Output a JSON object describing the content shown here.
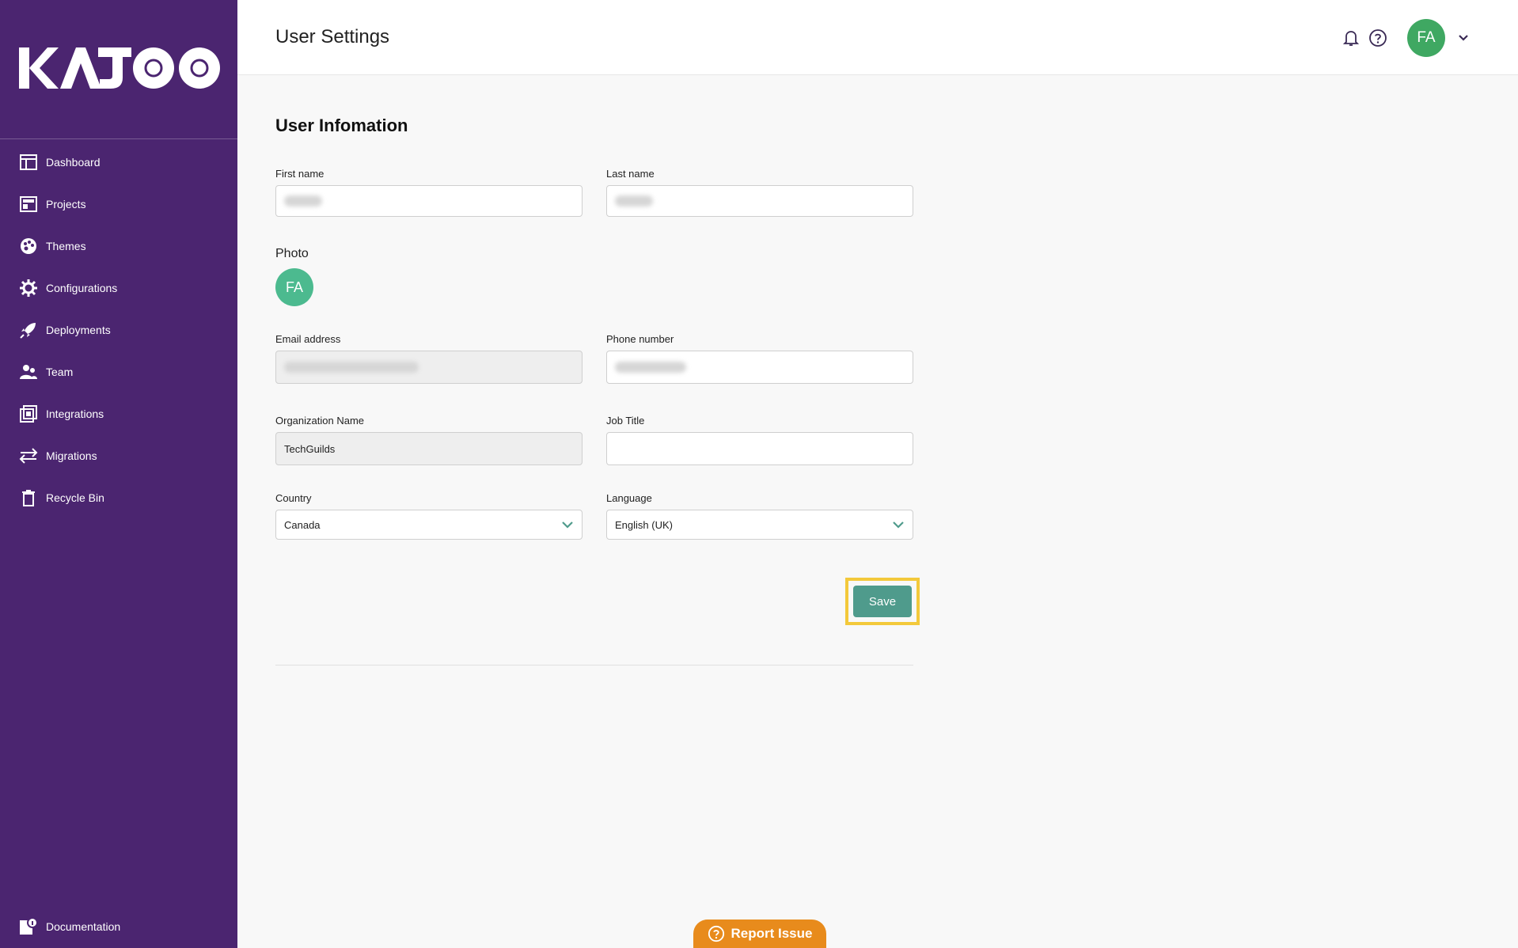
{
  "brand": {
    "logo": "KAJOO"
  },
  "sidebar": {
    "items": [
      {
        "label": "Dashboard",
        "icon": "dashboard-icon"
      },
      {
        "label": "Projects",
        "icon": "projects-icon"
      },
      {
        "label": "Themes",
        "icon": "palette-icon"
      },
      {
        "label": "Configurations",
        "icon": "gear-icon"
      },
      {
        "label": "Deployments",
        "icon": "rocket-icon"
      },
      {
        "label": "Team",
        "icon": "team-icon"
      },
      {
        "label": "Integrations",
        "icon": "integrations-icon"
      },
      {
        "label": "Migrations",
        "icon": "arrows-icon"
      },
      {
        "label": "Recycle Bin",
        "icon": "trash-icon"
      }
    ],
    "bottom": {
      "label": "Documentation",
      "icon": "documentation-icon"
    }
  },
  "header": {
    "title": "User Settings",
    "avatar_initials": "FA"
  },
  "form": {
    "section_title": "User Infomation",
    "first_name": {
      "label": "First name",
      "value": ""
    },
    "last_name": {
      "label": "Last name",
      "value": ""
    },
    "photo": {
      "label": "Photo",
      "initials": "FA"
    },
    "email": {
      "label": "Email address",
      "value": ""
    },
    "phone": {
      "label": "Phone number",
      "value": ""
    },
    "organization": {
      "label": "Organization Name",
      "value": "TechGuilds"
    },
    "job_title": {
      "label": "Job Title",
      "value": ""
    },
    "country": {
      "label": "Country",
      "value": "Canada"
    },
    "language": {
      "label": "Language",
      "value": "English (UK)"
    },
    "save_label": "Save"
  },
  "report": {
    "label": "Report Issue"
  },
  "colors": {
    "sidebar": "#4b2570",
    "accent": "#4f9b8c",
    "avatar": "#3fa862",
    "highlight": "#f3c93b",
    "report": "#e88b1c"
  }
}
